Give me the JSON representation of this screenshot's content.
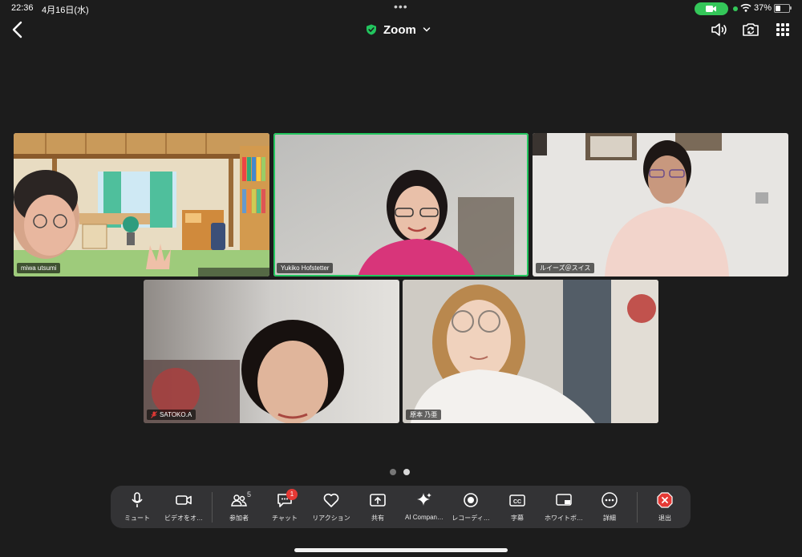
{
  "status_bar": {
    "time": "22:36",
    "date": "4月16日(水)",
    "battery": "37%",
    "battery_fraction": 0.37
  },
  "header": {
    "title": "Zoom"
  },
  "participants": [
    {
      "name": "miwa utsumi",
      "muted": false,
      "active_speaker": false
    },
    {
      "name": "Yukiko Hofstetter",
      "muted": false,
      "active_speaker": true
    },
    {
      "name": "ルイーズ＠スイス",
      "muted": false,
      "active_speaker": false
    },
    {
      "name": "SATOKO.A",
      "muted": true,
      "active_speaker": false
    },
    {
      "name": "原本 乃亜",
      "muted": false,
      "active_speaker": false
    }
  ],
  "pagination": {
    "total_pages": 2,
    "current_page": 2
  },
  "toolbar": {
    "mute_label": "ミュート",
    "video_label": "ビデオをオ…",
    "participants_label": "参加者",
    "participants_count": "5",
    "chat_label": "チャット",
    "chat_unread": "1",
    "reaction_label": "リアクション",
    "share_label": "共有",
    "ai_label": "AI Compan…",
    "record_label": "レコーディ…",
    "captions_label": "字幕",
    "whiteboard_label": "ホワイトボ…",
    "more_label": "詳細",
    "leave_label": "退出"
  },
  "colors": {
    "accent_green": "#22c55e",
    "status_green": "#34c759",
    "leave_red": "#e53935",
    "toolbar_bg": "#333335",
    "background": "#1c1c1c"
  }
}
